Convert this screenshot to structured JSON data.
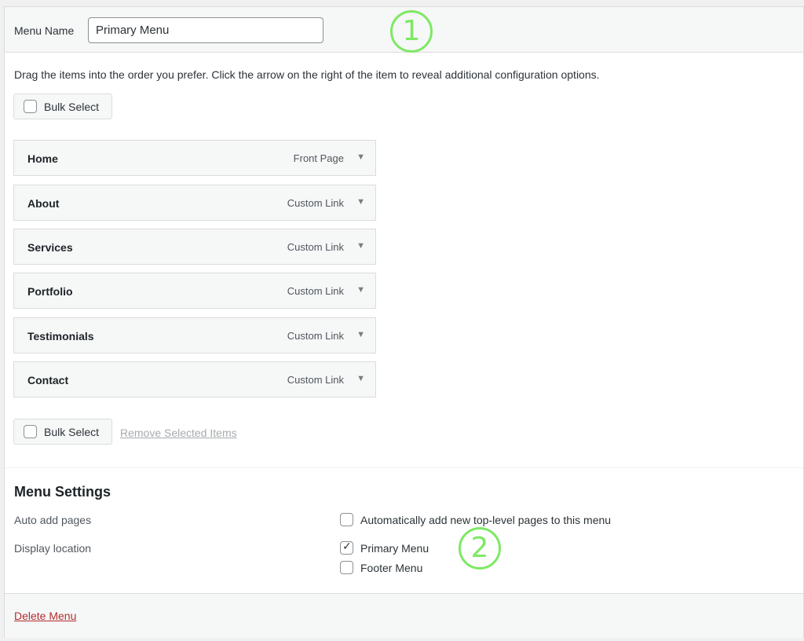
{
  "header": {
    "menu_name_label": "Menu Name",
    "menu_name_value": "Primary Menu"
  },
  "annotations": [
    "1",
    "2"
  ],
  "instructions": "Drag the items into the order you prefer. Click the arrow on the right of the item to reveal additional configuration options.",
  "bulk_select_label": "Bulk Select",
  "menu_items": [
    {
      "title": "Home",
      "type": "Front Page"
    },
    {
      "title": "About",
      "type": "Custom Link"
    },
    {
      "title": "Services",
      "type": "Custom Link"
    },
    {
      "title": "Portfolio",
      "type": "Custom Link"
    },
    {
      "title": "Testimonials",
      "type": "Custom Link"
    },
    {
      "title": "Contact",
      "type": "Custom Link"
    }
  ],
  "item_arrow_glyph": "▼",
  "remove_selected_label": "Remove Selected Items",
  "settings": {
    "title": "Menu Settings",
    "auto_add_label": "Auto add pages",
    "auto_add_option": "Automatically add new top-level pages to this menu",
    "display_location_label": "Display location",
    "locations": [
      {
        "label": "Primary Menu",
        "checked": true
      },
      {
        "label": "Footer Menu",
        "checked": false
      }
    ]
  },
  "delete_menu_label": "Delete Menu",
  "colors": {
    "annotation": "#7ee865",
    "delete_link": "#b32d2e",
    "disabled_link": "#a7aaad"
  }
}
